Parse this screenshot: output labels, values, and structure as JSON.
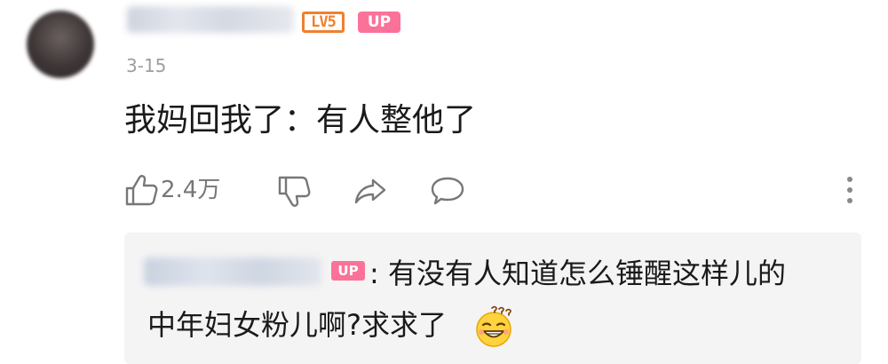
{
  "comment": {
    "level_badge": "LV5",
    "up_badge": "UP",
    "date": "3-15",
    "text": "我妈回我了：有人整他了",
    "like_count": "2.4万"
  },
  "icons": {
    "like": "thumbs-up-icon",
    "dislike": "thumbs-down-icon",
    "share": "share-arrow-icon",
    "reply": "comment-bubble-icon",
    "more": "more-vertical-icon",
    "emoji": "confused-laughing-emoji"
  },
  "reply": {
    "up_badge": "UP",
    "line1": ": 有没有人知道怎么锤醒这样儿的",
    "line2": "中年妇女粉儿啊?求求了"
  },
  "colors": {
    "up_pink": "#fb7299",
    "level_orange": "#f0802c",
    "reply_bg": "#f4f4f5"
  }
}
